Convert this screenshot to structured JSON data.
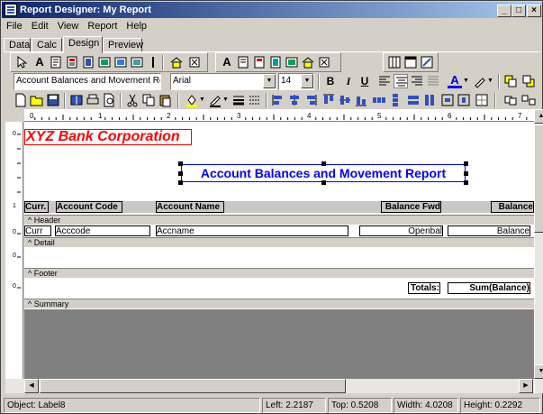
{
  "window": {
    "title": "Report Designer: My Report"
  },
  "menu": [
    "File",
    "Edit",
    "View",
    "Report",
    "Help"
  ],
  "tabs": [
    "Data",
    "Calc",
    "Design",
    "Preview"
  ],
  "format": {
    "label_text": "Account Balances and Movement Repor",
    "font": "Arial",
    "size": "14",
    "bold": "B",
    "italic": "I",
    "underline": "U"
  },
  "ruler": {
    "h_marks": [
      "0",
      "1",
      "2",
      "3",
      "4",
      "5",
      "6",
      "7"
    ],
    "v_marks": [
      "0",
      "1",
      "0",
      "0",
      "0"
    ]
  },
  "report": {
    "title_label": "XYZ Bank Corporation",
    "subtitle_label": "Account Balances and Movement Report",
    "columns": [
      "Curr.",
      "Account Code",
      "Account Name",
      "Balance Fwd",
      "Balance"
    ],
    "bands": [
      "Header",
      "Detail",
      "Footer",
      "Summary"
    ],
    "detail_fields": [
      "Curr",
      "Acccode",
      "Accname",
      "Openbal",
      "Balance"
    ],
    "footer_totals_label": "Totals:",
    "footer_sum": "Sum(Balance)"
  },
  "status": {
    "object": "Object: Label8",
    "left": "Left: 2.2187",
    "top": "Top: 0.5208",
    "width": "Width: 4.0208",
    "height": "Height: 0.2292"
  },
  "colors": {
    "title_red": "#ff0000",
    "subtitle_blue": "#0000ff",
    "titlebar": "#0a246a",
    "summary_gray": "#808080"
  }
}
